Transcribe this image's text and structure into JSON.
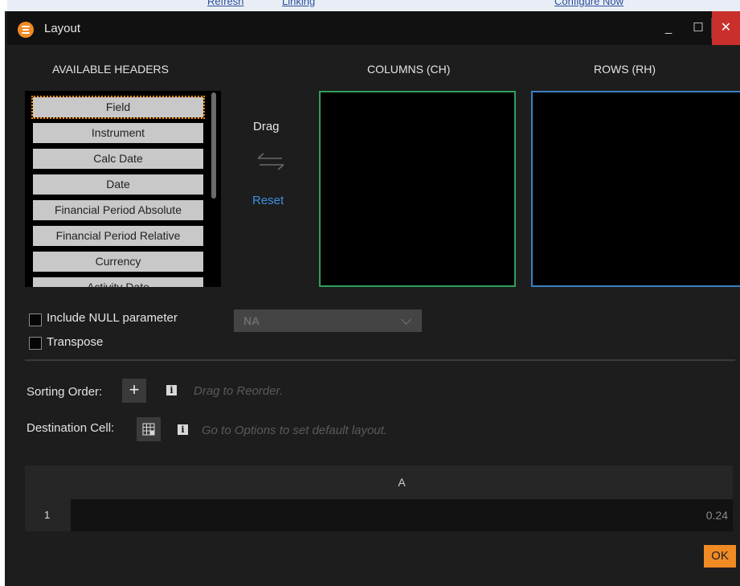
{
  "background": {
    "items": [
      "Refresh",
      "Linking",
      "Configure Now"
    ]
  },
  "window": {
    "title": "Layout",
    "minimize": "_",
    "maximize": "☐",
    "close": "✕",
    "accent": "#f08a24",
    "close_color": "#c9302c"
  },
  "headers": {
    "available": "AVAILABLE HEADERS",
    "columns": "COLUMNS (CH)",
    "rows": "ROWS (RH)"
  },
  "available_list": [
    "Field",
    "Instrument",
    "Calc Date",
    "Date",
    "Financial Period Absolute",
    "Financial Period Relative",
    "Currency",
    "Activity Date"
  ],
  "middle": {
    "drag_label": "Drag",
    "reset_label": "Reset",
    "swap_icon": "swap-arrows-icon"
  },
  "options": {
    "include_null_label": "Include NULL parameter",
    "transpose_label": "Transpose",
    "null_select_value": "NA"
  },
  "sorting": {
    "label": "Sorting Order:",
    "add_symbol": "+",
    "hint": "Drag to Reorder."
  },
  "destination": {
    "label": "Destination Cell:",
    "hint": "Go to Options to set default layout."
  },
  "preview": {
    "column_header": "A",
    "row_header": "1",
    "cell_value": "0.24"
  },
  "footer": {
    "ok_label": "OK"
  },
  "colors": {
    "columns_border": "#2fa05a",
    "rows_border": "#3b7fc4",
    "link": "#3e8fe0"
  }
}
